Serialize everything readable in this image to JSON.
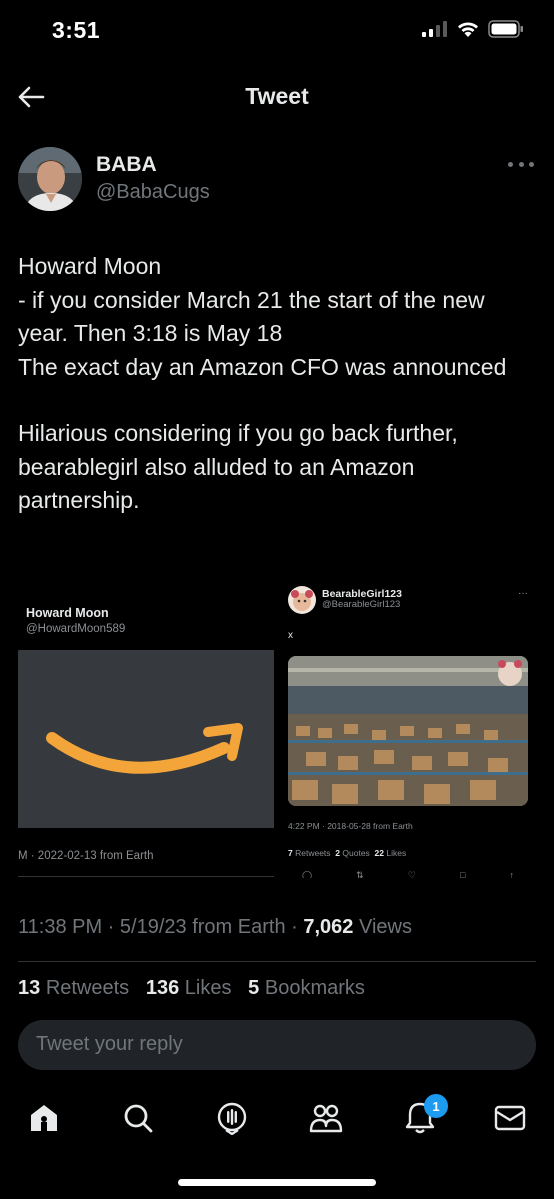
{
  "status_bar": {
    "time": "3:51"
  },
  "header": {
    "title": "Tweet"
  },
  "author": {
    "name": "BABA",
    "handle": "@BabaCugs"
  },
  "tweet": {
    "paragraph_1": "Howard Moon\n- if you consider March 21 the start of the new year. Then 3:18 is May 18\nThe exact day an Amazon CFO was announced",
    "paragraph_2": "Hilarious considering if you go back further, bearablegirl also alluded to an Amazon partnership."
  },
  "media": {
    "left": {
      "name": "Howard Moon",
      "handle": "@HowardMoon589",
      "meta": "M · 2022-02-13 from Earth"
    },
    "right": {
      "name": "BearableGirl123",
      "handle": "@BearableGirl123",
      "text": "x",
      "meta": "4:22 PM · 2018-05-28 from Earth",
      "retweets_count": "7",
      "retweets_label": "Retweets",
      "quotes_count": "2",
      "quotes_label": "Quotes",
      "likes_count": "22",
      "likes_label": "Likes"
    }
  },
  "meta": {
    "time": "11:38 PM",
    "date": "5/19/23",
    "source": "from Earth",
    "views_count": "7,062",
    "views_label": "Views"
  },
  "engagement": {
    "retweets_count": "13",
    "retweets_label": "Retweets",
    "likes_count": "136",
    "likes_label": "Likes",
    "bookmarks_count": "5",
    "bookmarks_label": "Bookmarks"
  },
  "reply": {
    "placeholder": "Tweet your reply"
  },
  "nav": {
    "notifications_badge": "1"
  },
  "colors": {
    "accent": "#1d9bf0",
    "background": "#000000",
    "secondary_text": "#71767b",
    "amazon_orange": "#f3a53a"
  }
}
